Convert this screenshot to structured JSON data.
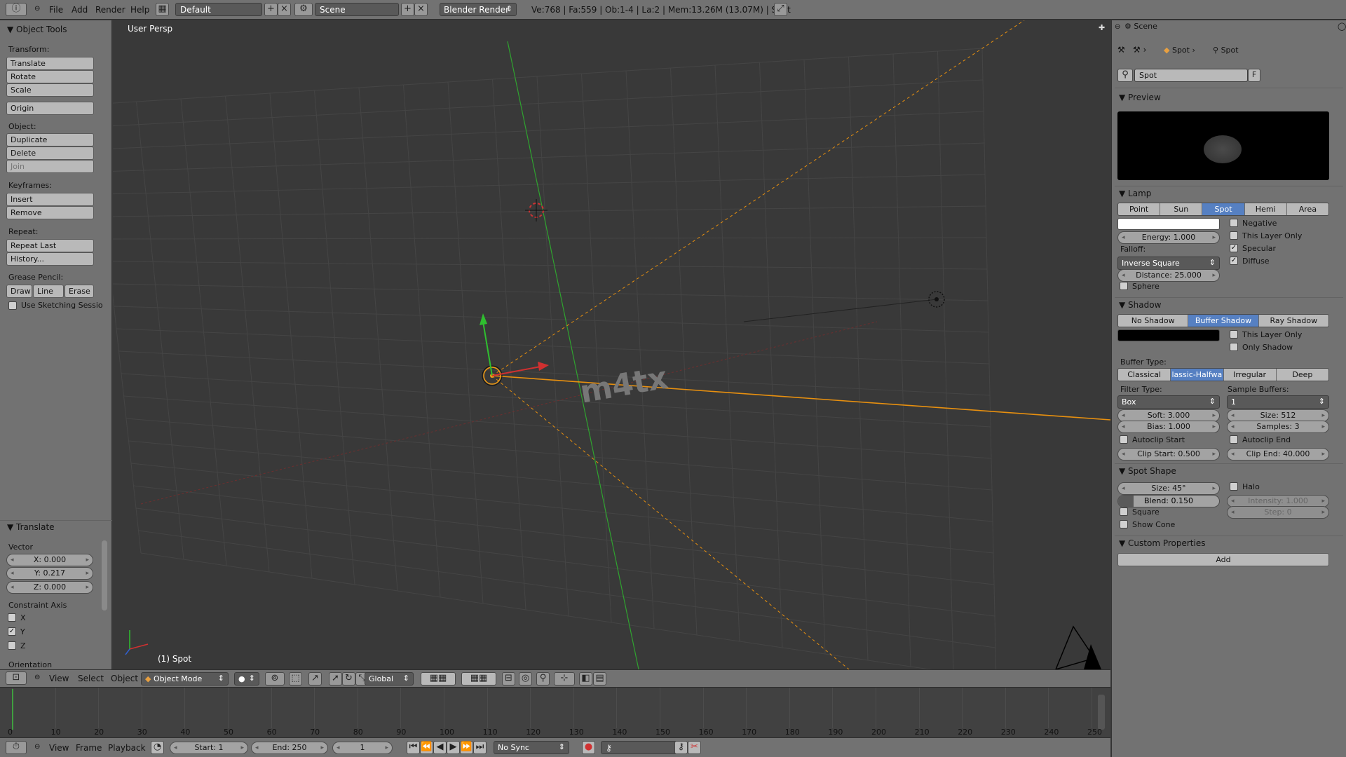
{
  "topbar": {
    "menus": [
      "File",
      "Add",
      "Render",
      "Help"
    ],
    "layout": "Default",
    "scene": "Scene",
    "engine": "Blender Render",
    "stats": "Ve:768 | Fa:559 | Ob:1-4 | La:2 | Mem:13.26M (13.07M) | Spot"
  },
  "tools": {
    "title": "Object Tools",
    "transform_label": "Transform:",
    "translate": "Translate",
    "rotate": "Rotate",
    "scale": "Scale",
    "origin": "Origin",
    "object_label": "Object:",
    "duplicate": "Duplicate",
    "delete": "Delete",
    "join": "Join",
    "keyframes_label": "Keyframes:",
    "insert": "Insert",
    "remove": "Remove",
    "repeat_label": "Repeat:",
    "repeat_last": "Repeat Last",
    "history": "History...",
    "grease_label": "Grease Pencil:",
    "draw": "Draw",
    "line": "Line",
    "erase": "Erase",
    "sketching": "Use Sketching Sessio"
  },
  "operator": {
    "title": "Translate",
    "vector_label": "Vector",
    "x": "X: 0.000",
    "y": "Y: 0.217",
    "z": "Z: 0.000",
    "constraint_label": "Constraint Axis",
    "cx": "X",
    "cy": "Y",
    "cz": "Z",
    "orientation_label": "Orientation"
  },
  "viewport": {
    "view_name": "User Persp",
    "object_name": "(1) Spot",
    "watermark": "m4tx"
  },
  "view_header": {
    "menus": [
      "View",
      "Select",
      "Object"
    ],
    "mode": "Object Mode",
    "orientation": "Global"
  },
  "timeline": {
    "ticks": [
      "0",
      "10",
      "20",
      "30",
      "40",
      "50",
      "60",
      "70",
      "80",
      "90",
      "100",
      "110",
      "120",
      "130",
      "140",
      "150",
      "160",
      "170",
      "180",
      "190",
      "200",
      "210",
      "220",
      "230",
      "240",
      "250"
    ],
    "menus": [
      "View",
      "Frame",
      "Playback"
    ],
    "start": "Start: 1",
    "end": "End: 250",
    "frame": "1",
    "sync": "No Sync"
  },
  "props": {
    "scene_label": "Scene",
    "crumb1": "Spot",
    "crumb2": "Spot",
    "datablock": "Spot",
    "fake_user": "F",
    "preview_title": "Preview",
    "lamp_title": "Lamp",
    "lamp_types": [
      "Point",
      "Sun",
      "Spot",
      "Hemi",
      "Area"
    ],
    "lamp_selected": 2,
    "energy": "Energy: 1.000",
    "negative": "Negative",
    "this_layer_only": "This Layer Only",
    "specular": "Specular",
    "diffuse": "Diffuse",
    "falloff_label": "Falloff:",
    "falloff": "Inverse Square",
    "distance": "Distance: 25.000",
    "sphere": "Sphere",
    "shadow_title": "Shadow",
    "shadow_types": [
      "No Shadow",
      "Buffer Shadow",
      "Ray Shadow"
    ],
    "shadow_selected": 1,
    "shadow_layer_only": "This Layer Only",
    "only_shadow": "Only Shadow",
    "buffer_type_label": "Buffer Type:",
    "buffer_types": [
      "Classical",
      "lassic-Halfwa",
      "Irregular",
      "Deep"
    ],
    "buffer_selected": 1,
    "filter_type_label": "Filter Type:",
    "filter_type": "Box",
    "sample_buffers_label": "Sample Buffers:",
    "sample_buffers": "1",
    "soft": "Soft: 3.000",
    "size": "Size: 512",
    "bias": "Bias: 1.000",
    "samples": "Samples: 3",
    "autoclip_start": "Autoclip Start",
    "autoclip_end": "Autoclip End",
    "clip_start": "Clip Start: 0.500",
    "clip_end": "Clip End: 40.000",
    "spot_shape_title": "Spot Shape",
    "spot_size": "Size: 45°",
    "halo": "Halo",
    "blend": "Blend: 0.150",
    "intensity": "Intensity: 1.000",
    "square": "Square",
    "step": "Step: 0",
    "show_cone": "Show Cone",
    "custom_props_title": "Custom Properties",
    "add": "Add"
  },
  "colors": {
    "accent": "#5680c2",
    "selection": "#f39c12",
    "y_axis": "#2fa32f",
    "x_axis": "#b03030"
  }
}
